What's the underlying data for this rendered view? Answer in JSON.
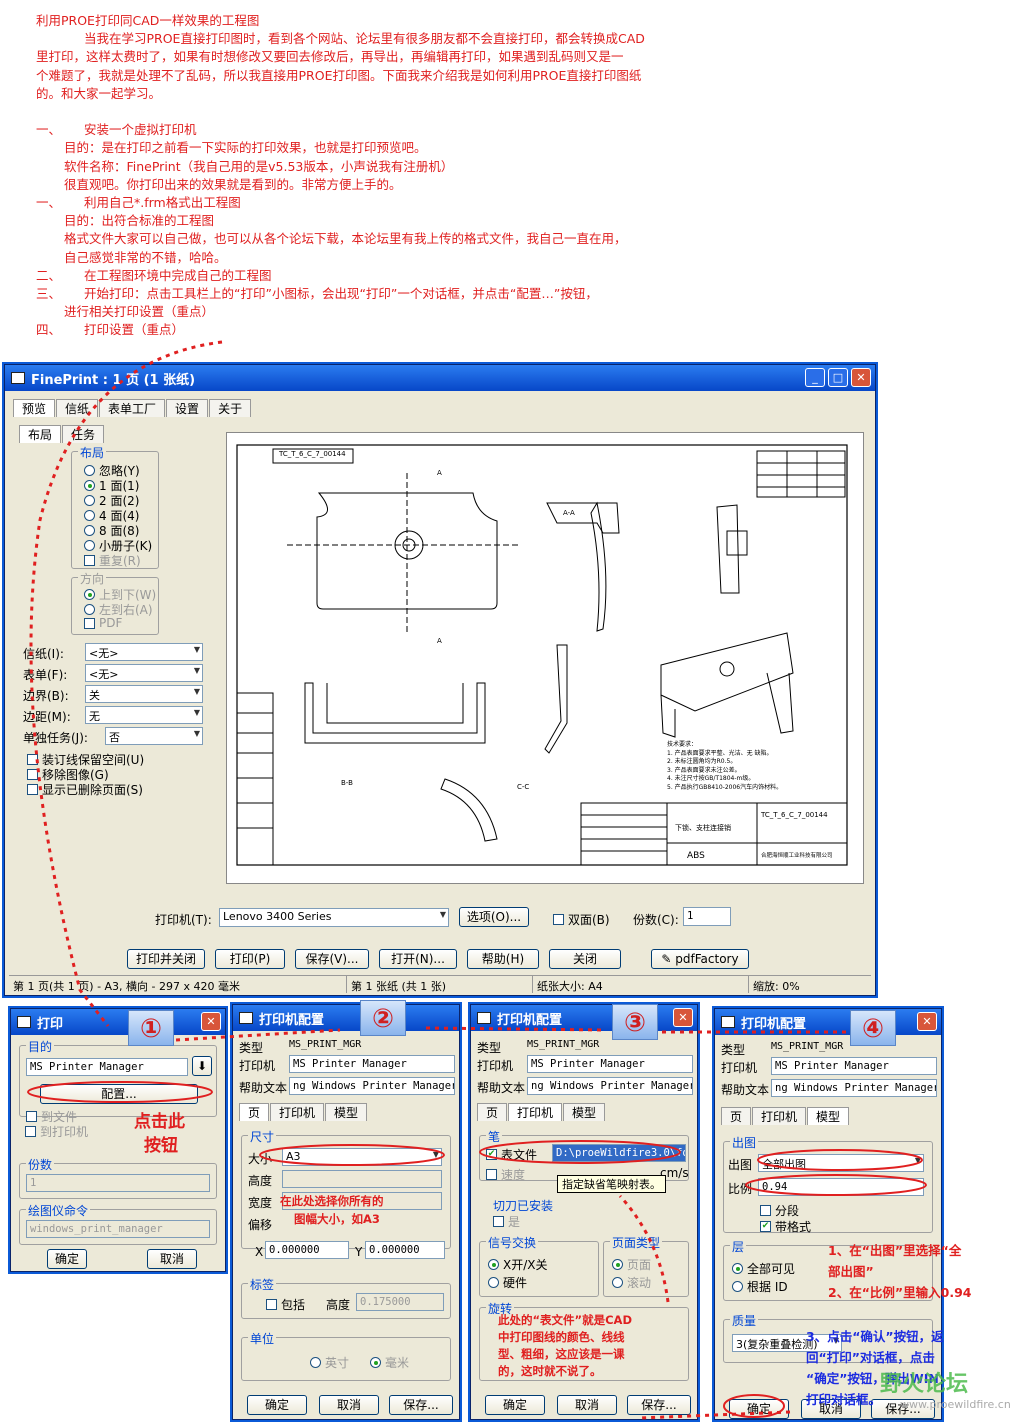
{
  "intro": {
    "title": "利用PROE打印同CAD一样效果的工程图",
    "para": [
      "当我在学习PROE直接打印图时，看到各个网站、论坛里有很多朋友都不会直接打印，都会转换成CAD",
      "里打印，这样太费时了，如果有时想修改又要回去修改后，再导出，再编辑再打印，如果遇到乱码则又是一",
      "个难题了，我就是处理不了乱码，所以我直接用PROE打印图。下面我来介绍我是如何利用PROE直接打印图纸",
      "的。和大家一起学习。"
    ],
    "s1_num": "一、",
    "s1": "安装一个虚拟打印机",
    "s1_l1": "目的：是在打印之前看一下实际的打印效果，也就是打印预览吧。",
    "s1_l2": "软件名称：FinePrint（我自己用的是v5.53版本，小声说我有注册机）",
    "s1_l3": "很直观吧。你打印出来的效果就是看到的。非常方便上手的。",
    "s2_num": "一、",
    "s2": "利用自己*.frm格式出工程图",
    "s2_l1": "目的：出符合标准的工程图",
    "s2_l2": "格式文件大家可以自己做，也可以从各个论坛下载，本论坛里有我上传的格式文件，我自己一直在用，",
    "s2_l3": "自己感觉非常的不错，哈哈。",
    "s3_num": "二、",
    "s3": "在工程图环境中完成自己的工程图",
    "s4_num": "三、",
    "s4": "开始打印：点击工具栏上的“打印”小图标，会出现“打印”一个对话框，并点击“配置…”按钮，",
    "s4_l1": "进行相关打印设置（重点）",
    "s5_num": "四、",
    "s5": "打印设置（重点）"
  },
  "fineprint": {
    "title": "FinePrint : 1 页 (1 张纸)",
    "tabs": [
      "预览",
      "信纸",
      "表单工厂",
      "设置",
      "关于"
    ],
    "subtabs": [
      "布局",
      "任务"
    ],
    "layout_group": "布局",
    "layout_opts": [
      "忽略(Y)",
      "1 面(1)",
      "2 面(2)",
      "4 面(4)",
      "8 面(8)",
      "小册子(K)"
    ],
    "reverse": "重复(R)",
    "dir_group": "方向",
    "dir_opts": [
      "上到下(W)",
      "左到右(A)"
    ],
    "pdf": "PDF",
    "rows": [
      {
        "label": "信纸(I):",
        "value": "<无>"
      },
      {
        "label": "表单(F):",
        "value": "<无>"
      },
      {
        "label": "边界(B):",
        "value": "关"
      },
      {
        "label": "边距(M):",
        "value": "无"
      },
      {
        "label": "单独任务(J):",
        "value": "否"
      }
    ],
    "checks": [
      "装订线保留空间(U)",
      "移除图像(G)",
      "显示已删除页面(S)"
    ],
    "printer_label": "打印机(T):",
    "printer": "Lenovo 3400 Series",
    "options_btn": "选项(O)...",
    "duplex": "双面(B)",
    "copies_label": "份数(C):",
    "copies": "1",
    "buttons": [
      "打印并关闭",
      "打印(P)",
      "保存(V)...",
      "打开(N)...",
      "帮助(H)",
      "关闭"
    ],
    "pdf_btn": "pdfFactory",
    "status": [
      "第 1 页(共 1 页) - A3, 横向 - 297 x 420 毫米",
      "第 1 张纸 (共 1 张)",
      "纸张大小: A4",
      "缩放: 0%"
    ]
  },
  "drawing": {
    "partno": "TC_T_6_C_7_00144",
    "material": "ABS",
    "title": "下锁、支柱连接销",
    "company": "合肥海恒顺工业科技有限公司",
    "tech_title": "技术要求：",
    "tech": [
      "1. 产品表面要求平整、光洁、无  缺陷。",
      "2. 未标注圆角均为R0.5。",
      "3. 产品表面要求未注公差。",
      "4. 未注尺寸按GB/T1804-m级。",
      "5. 产品执行GB8410-2006汽车内饰材料。"
    ],
    "labels": [
      "A-A",
      "B-B",
      "C-C",
      "A",
      "A"
    ]
  },
  "print_dlg": {
    "title": "打印",
    "dest_group": "目的",
    "dest": "MS Printer Manager",
    "config_btn": "配置...",
    "to_file": "到文件",
    "to_printer": "到打印机",
    "copies_group": "份数",
    "copies": "1",
    "plotter_group": "绘图仪命令",
    "plotter": "windows_print_manager",
    "ok": "确定",
    "cancel": "取消",
    "note": [
      "点击此",
      "按钮"
    ]
  },
  "cfg": {
    "title": "打印机配置",
    "type_label": "类型",
    "type": "MS_PRINT_MGR",
    "printer_label": "打印机",
    "printer": "MS Printer Manager",
    "help_label": "帮助文本",
    "help": "ng Windows Printer Manager.",
    "tabs": [
      "页",
      "打印机",
      "模型"
    ],
    "ok": "确定",
    "cancel": "取消",
    "save": "保存..."
  },
  "cfg2": {
    "size_group": "尺寸",
    "size_label": "大小",
    "size": "A3",
    "height_label": "高度",
    "width_label": "宽度",
    "offset_group": "偏移",
    "x_label": "X",
    "x": "0.000000",
    "y_label": "Y",
    "y": "0.000000",
    "tag_group": "标签",
    "include": "包括",
    "tag_h_label": "高度",
    "tag_h": "0.175000",
    "unit_group": "单位",
    "unit_opts": [
      "英寸",
      "毫米"
    ],
    "note": [
      "在此处选择你所有的",
      "图幅大小，如A3"
    ]
  },
  "cfg3": {
    "pen_group": "笔",
    "table_file": "表文件",
    "table_path": "D:\\proeWildfire3.0\\for",
    "speed": "速度",
    "speed_unit": "cm/s",
    "tooltip": "指定缺省笔映射表。",
    "cutter_group": "切刀已安装",
    "cutter": "是",
    "signal_group": "信号交换",
    "signal_opts": [
      "X开/X关",
      "硬件"
    ],
    "pagetype_group": "页面类型",
    "pagetype_opts": [
      "页面",
      "滚动"
    ],
    "rotate_group": "旋转",
    "note": [
      "此处的“表文件”就是CAD",
      "中打印图线的颜色、线线",
      "型、粗细，这应该是一课",
      "的，这时就不说了。"
    ]
  },
  "cfg4": {
    "out_group": "出图",
    "out_label": "出图",
    "out": "全部出图",
    "scale_label": "比例",
    "scale": "0.94",
    "segment": "分段",
    "with_format": "带格式",
    "layer_group": "层",
    "layer_opts": [
      "全部可见",
      "根据 ID"
    ],
    "quality_group": "质量",
    "quality": "3(复杂重叠检测)",
    "note": [
      "1、在“出图”里选择“全",
      "部出图”",
      "2、在“比例”里输入0.94",
      "3、点击“确认”按钮，返",
      "回“打印”对话框，点击",
      "“确定”按钮，弹出WIN",
      "打印对话框。"
    ]
  },
  "badges": [
    "①",
    "②",
    "③",
    "④"
  ],
  "watermark": {
    "text": "野火论坛",
    "url": "www.proewildfire.cn"
  },
  "colors": {
    "accent": "#e02020",
    "titlebar": "#0747c8",
    "note_blue": "#1b2be0"
  }
}
